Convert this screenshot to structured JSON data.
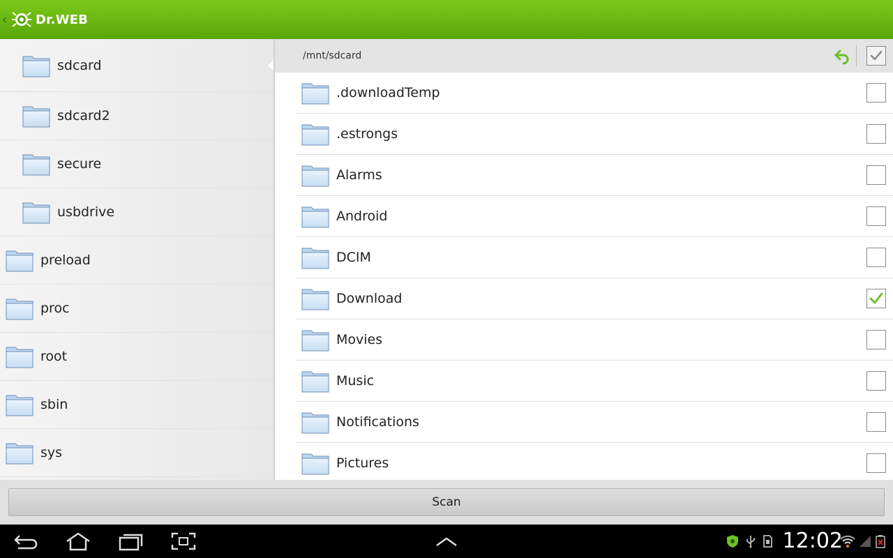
{
  "app": {
    "brand": "Dr.WEB"
  },
  "tree": [
    {
      "label": "sdcard",
      "level": "sub",
      "selected": true
    },
    {
      "label": "sdcard2",
      "level": "sub",
      "selected": false
    },
    {
      "label": "secure",
      "level": "sub",
      "selected": false
    },
    {
      "label": "usbdrive",
      "level": "sub",
      "selected": false
    },
    {
      "label": "preload",
      "level": "top",
      "selected": false
    },
    {
      "label": "proc",
      "level": "top",
      "selected": false
    },
    {
      "label": "root",
      "level": "top",
      "selected": false
    },
    {
      "label": "sbin",
      "level": "top",
      "selected": false
    },
    {
      "label": "sys",
      "level": "top",
      "selected": false
    }
  ],
  "path": "/mnt/sdcard",
  "files": [
    {
      "label": ".downloadTemp",
      "checked": false
    },
    {
      "label": ".estrongs",
      "checked": false
    },
    {
      "label": "Alarms",
      "checked": false
    },
    {
      "label": "Android",
      "checked": false
    },
    {
      "label": "DCIM",
      "checked": false
    },
    {
      "label": "Download",
      "checked": true
    },
    {
      "label": "Movies",
      "checked": false
    },
    {
      "label": "Music",
      "checked": false
    },
    {
      "label": "Notifications",
      "checked": false
    },
    {
      "label": "Pictures",
      "checked": false
    }
  ],
  "scan_label": "Scan",
  "status": {
    "time": "12:02"
  },
  "colors": {
    "accent": "#66b812",
    "check": "#6dbf2a"
  },
  "icons": {
    "folder": "folder-icon",
    "back": "back-arrow-icon",
    "check": "checkmark-icon",
    "nav_back": "nav-back-icon",
    "nav_home": "nav-home-icon",
    "nav_recent": "nav-recent-apps-icon",
    "nav_screenshot": "screenshot-icon",
    "nav_up": "chevron-up-icon"
  }
}
